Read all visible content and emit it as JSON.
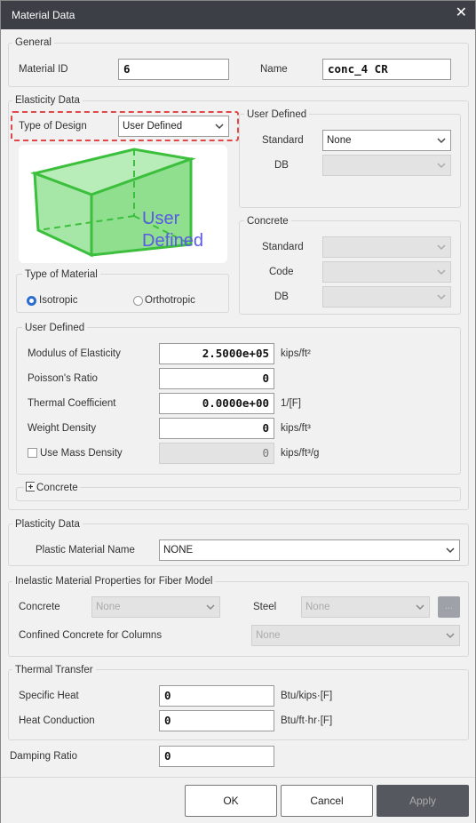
{
  "window": {
    "title": "Material Data",
    "close_icon": "close-icon"
  },
  "general": {
    "legend": "General",
    "material_id_label": "Material ID",
    "material_id_value": "6",
    "name_label": "Name",
    "name_value": "conc_4 CR"
  },
  "elasticity": {
    "legend": "Elasticity Data",
    "type_of_design_label": "Type of Design",
    "type_of_design_value": "User Defined",
    "preview_text_line1": "User",
    "preview_text_line2": "Defined",
    "type_of_material": {
      "legend": "Type of Material",
      "isotropic": "Isotropic",
      "orthotropic": "Orthotropic",
      "selected": "Isotropic"
    },
    "user_defined_box": {
      "legend": "User Defined",
      "standard_label": "Standard",
      "standard_value": "None",
      "db_label": "DB",
      "db_value": ""
    },
    "concrete_box": {
      "legend": "Concrete",
      "standard_label": "Standard",
      "code_label": "Code",
      "db_label": "DB"
    },
    "user_defined": {
      "legend": "User Defined",
      "modulus_label": "Modulus of Elasticity",
      "modulus_value": "2.5000e+05",
      "modulus_unit": "kips/ft²",
      "poisson_label": "Poisson's Ratio",
      "poisson_value": "0",
      "thermal_label": "Thermal Coefficient",
      "thermal_value": "0.0000e+00",
      "thermal_unit": "1/[F]",
      "weight_label": "Weight Density",
      "weight_value": "0",
      "weight_unit": "kips/ft³",
      "mass_label": "Use Mass Density",
      "mass_value": "0",
      "mass_unit": "kips/ft³/g"
    },
    "concrete_expander": "Concrete"
  },
  "plasticity": {
    "legend": "Plasticity Data",
    "plastic_name_label": "Plastic Material Name",
    "plastic_name_value": "NONE"
  },
  "inelastic": {
    "legend": "Inelastic Material Properties for Fiber Model",
    "concrete_label": "Concrete",
    "concrete_value": "None",
    "steel_label": "Steel",
    "steel_value": "None",
    "confined_label": "Confined Concrete for Columns",
    "confined_value": "None",
    "more_button": "..."
  },
  "thermal_transfer": {
    "legend": "Thermal Transfer",
    "specific_heat_label": "Specific Heat",
    "specific_heat_value": "0",
    "specific_heat_unit": "Btu/kips·[F]",
    "heat_conduction_label": "Heat Conduction",
    "heat_conduction_value": "0",
    "heat_conduction_unit": "Btu/ft·hr·[F]"
  },
  "damping": {
    "label": "Damping Ratio",
    "value": "0"
  },
  "buttons": {
    "ok": "OK",
    "cancel": "Cancel",
    "apply": "Apply"
  },
  "colors": {
    "titlebar": "#3c3f46",
    "accent": "#2a6dcf",
    "highlight": "#e04848",
    "box_green": "#3cbf3c",
    "preview_text": "#5a5ae6"
  }
}
